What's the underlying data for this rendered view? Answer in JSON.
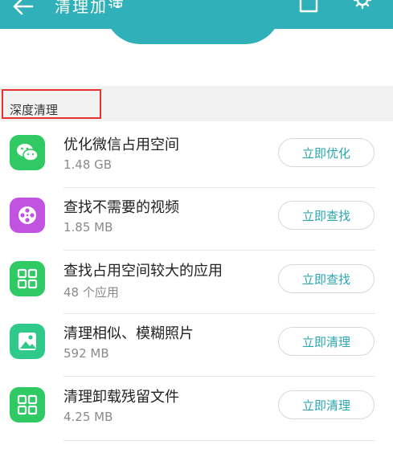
{
  "header": {
    "title": "清理加速",
    "back_icon": "back-arrow-icon",
    "right_icons": [
      "phone-icon",
      "gear-icon"
    ],
    "color": "#30b0b8"
  },
  "section": {
    "label": "深度清理",
    "highlight_color": "#e5322d"
  },
  "items": [
    {
      "title": "优化微信占用空间",
      "subtitle": "1.48 GB",
      "button": "立即优化",
      "icon": "wechat-icon",
      "icon_color": "#2fca64"
    },
    {
      "title": "查找不需要的视频",
      "subtitle": "1.85 MB",
      "button": "立即查找",
      "icon": "video-reel-icon",
      "icon_color": "#c252e0"
    },
    {
      "title": "查找占用空间较大的应用",
      "subtitle": "48 个应用",
      "button": "立即查找",
      "icon": "apps-grid-icon",
      "icon_color": "#2fca64"
    },
    {
      "title": "清理相似、模糊照片",
      "subtitle": "592 MB",
      "button": "立即清理",
      "icon": "photo-icon",
      "icon_color": "#2fca8a"
    },
    {
      "title": "清理卸载残留文件",
      "subtitle": "4.25 MB",
      "button": "立即清理",
      "icon": "apps-grid-icon",
      "icon_color": "#2fca64"
    }
  ]
}
